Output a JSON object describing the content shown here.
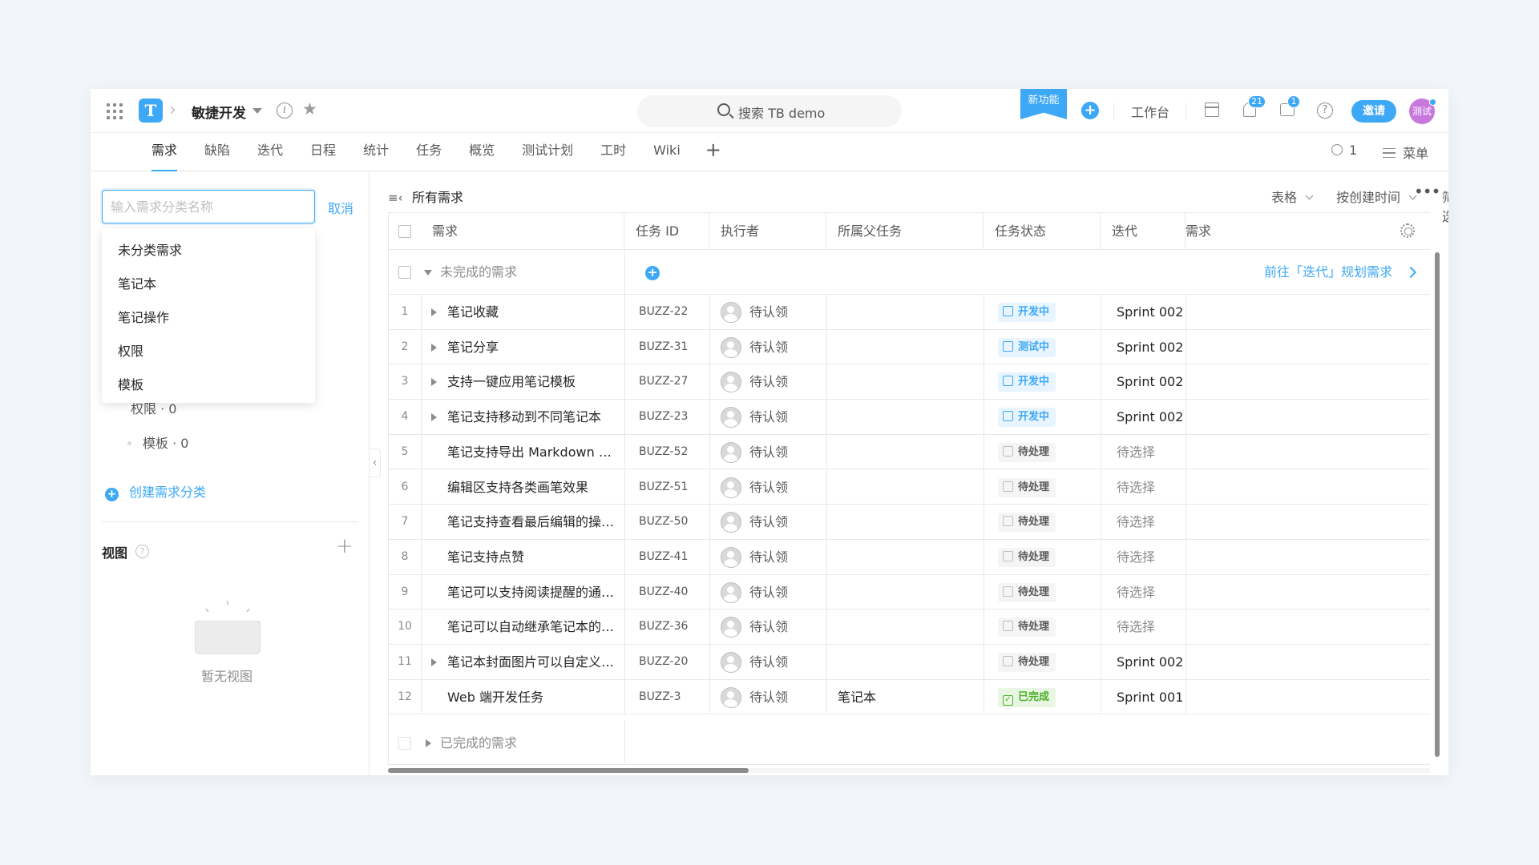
{
  "topbar": {
    "logo_letter": "T",
    "project_name": "敏捷开发",
    "search_placeholder": "搜索 TB demo",
    "new_feature": "新功能",
    "workbench": "工作台",
    "bell_count": "21",
    "chat_count": "1",
    "help": "?",
    "invite": "邀请",
    "avatar_text": "测试"
  },
  "tabs": [
    "需求",
    "缺陷",
    "迭代",
    "日程",
    "统计",
    "任务",
    "概览",
    "测试计划",
    "工时",
    "Wiki"
  ],
  "tab_add": "+",
  "active_tab": 0,
  "tabbar_right": {
    "member_count": "1",
    "menu": "菜单"
  },
  "sidebar": {
    "input_placeholder": "输入需求分类名称",
    "cancel": "取消",
    "dropdown_items": [
      "未分类需求",
      "笔记本",
      "笔记操作",
      "权限",
      "模板"
    ],
    "partially_hidden_item": "权限 · 0",
    "tree_item": "模板 · 0",
    "create_category": "创建需求分类",
    "view_title": "视图",
    "view_help": "?",
    "view_add": "+",
    "empty_text": "暂无视图"
  },
  "toolbar": {
    "title": "所有需求",
    "view_mode": "表格",
    "sort": "按创建时间",
    "filter": "筛选",
    "more": "•••"
  },
  "table": {
    "columns": [
      "需求",
      "任务 ID",
      "执行者",
      "所属父任务",
      "任务状态",
      "迭代",
      "需求"
    ],
    "group_incomplete": "未完成的需求",
    "plan_link": "前往「迭代」规划需求",
    "group_complete": "已完成的需求",
    "rows": [
      {
        "num": "1",
        "expand": true,
        "title": "笔记收藏",
        "id": "BUZZ-22",
        "assignee": "待认领",
        "parent": "",
        "status": "开发中",
        "status_type": "dev",
        "sprint": "Sprint 002"
      },
      {
        "num": "2",
        "expand": true,
        "title": "笔记分享",
        "id": "BUZZ-31",
        "assignee": "待认领",
        "parent": "",
        "status": "测试中",
        "status_type": "dev",
        "sprint": "Sprint 002"
      },
      {
        "num": "3",
        "expand": true,
        "title": "支持一键应用笔记模板",
        "id": "BUZZ-27",
        "assignee": "待认领",
        "parent": "",
        "status": "开发中",
        "status_type": "dev",
        "sprint": "Sprint 002"
      },
      {
        "num": "4",
        "expand": true,
        "title": "笔记支持移动到不同笔记本",
        "id": "BUZZ-23",
        "assignee": "待认领",
        "parent": "",
        "status": "开发中",
        "status_type": "dev",
        "sprint": "Sprint 002"
      },
      {
        "num": "5",
        "expand": false,
        "title": "笔记支持导出 Markdown 文本",
        "id": "BUZZ-52",
        "assignee": "待认领",
        "parent": "",
        "status": "待处理",
        "status_type": "todo",
        "sprint": "待选择"
      },
      {
        "num": "6",
        "expand": false,
        "title": "编辑区支持各类画笔效果",
        "id": "BUZZ-51",
        "assignee": "待认领",
        "parent": "",
        "status": "待处理",
        "status_type": "todo",
        "sprint": "待选择"
      },
      {
        "num": "7",
        "expand": false,
        "title": "笔记支持查看最后编辑的操作者和...",
        "id": "BUZZ-50",
        "assignee": "待认领",
        "parent": "",
        "status": "待处理",
        "status_type": "todo",
        "sprint": "待选择"
      },
      {
        "num": "8",
        "expand": false,
        "title": "笔记支持点赞",
        "id": "BUZZ-41",
        "assignee": "待认领",
        "parent": "",
        "status": "待处理",
        "status_type": "todo",
        "sprint": "待选择"
      },
      {
        "num": "9",
        "expand": false,
        "title": "笔记可以支持阅读提醒的通知设置",
        "id": "BUZZ-40",
        "assignee": "待认领",
        "parent": "",
        "status": "待处理",
        "status_type": "todo",
        "sprint": "待选择"
      },
      {
        "num": "10",
        "expand": false,
        "title": "笔记可以自动继承笔记本的权限",
        "id": "BUZZ-36",
        "assignee": "待认领",
        "parent": "",
        "status": "待处理",
        "status_type": "todo",
        "sprint": "待选择"
      },
      {
        "num": "11",
        "expand": true,
        "title": "笔记本封面图片可以自定义修改",
        "id": "BUZZ-20",
        "assignee": "待认领",
        "parent": "",
        "status": "待处理",
        "status_type": "todo",
        "sprint": "Sprint 002"
      },
      {
        "num": "12",
        "expand": false,
        "title": "Web 端开发任务",
        "id": "BUZZ-3",
        "assignee": "待认领",
        "parent": "笔记本",
        "status": "已完成",
        "status_type": "done",
        "sprint": "Sprint 001"
      }
    ]
  },
  "colors": {
    "accent": "#3da8f5",
    "dev_status_bg": "#e8f4fe",
    "done_status_bg": "#e9f6e3",
    "done_status_fg": "#4caf2a",
    "todo_status_bg": "#f5f5f5"
  }
}
